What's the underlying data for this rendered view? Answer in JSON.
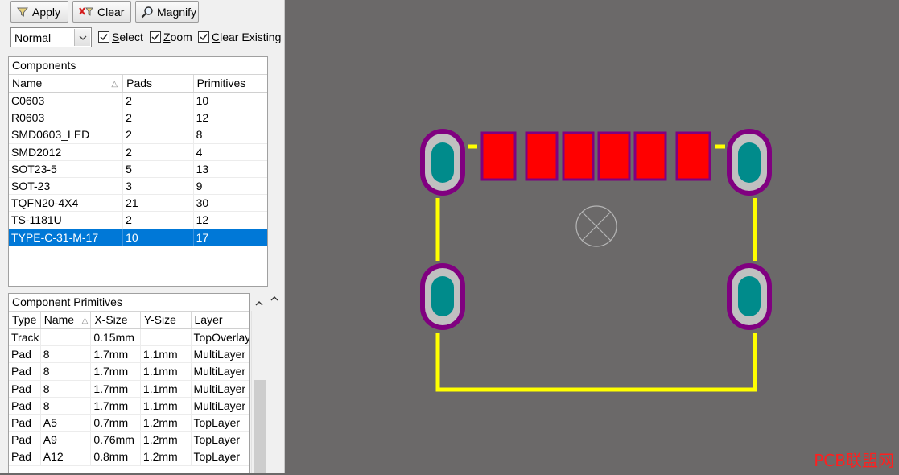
{
  "toolbar": {
    "apply_label": "Apply",
    "clear_label": "Clear",
    "magnify_label": "Magnify"
  },
  "filter": {
    "mode_value": "Normal",
    "select_label": "Select",
    "zoom_label": "Zoom",
    "clear_existing_label": "Clear Existing",
    "select_checked": true,
    "zoom_checked": true,
    "clear_existing_checked": true
  },
  "components": {
    "title": "Components",
    "columns": [
      "Name",
      "Pads",
      "Primitives"
    ],
    "rows": [
      {
        "name": "C0603",
        "pads": "2",
        "primitives": "10"
      },
      {
        "name": "R0603",
        "pads": "2",
        "primitives": "12"
      },
      {
        "name": "SMD0603_LED",
        "pads": "2",
        "primitives": "8"
      },
      {
        "name": "SMD2012",
        "pads": "2",
        "primitives": "4"
      },
      {
        "name": "SOT23-5",
        "pads": "5",
        "primitives": "13"
      },
      {
        "name": "SOT-23",
        "pads": "3",
        "primitives": "9"
      },
      {
        "name": "TQFN20-4X4",
        "pads": "21",
        "primitives": "30"
      },
      {
        "name": "TS-1181U",
        "pads": "2",
        "primitives": "12"
      },
      {
        "name": "TYPE-C-31-M-17",
        "pads": "10",
        "primitives": "17"
      }
    ],
    "selected_index": 8
  },
  "primitives": {
    "title": "Component Primitives",
    "columns": [
      "Type",
      "Name",
      "X-Size",
      "Y-Size",
      "Layer"
    ],
    "rows": [
      {
        "type": "Track",
        "name": "",
        "xsize": "0.15mm",
        "ysize": "",
        "layer": "TopOverlay"
      },
      {
        "type": "Pad",
        "name": "8",
        "xsize": "1.7mm",
        "ysize": "1.1mm",
        "layer": "MultiLayer"
      },
      {
        "type": "Pad",
        "name": "8",
        "xsize": "1.7mm",
        "ysize": "1.1mm",
        "layer": "MultiLayer"
      },
      {
        "type": "Pad",
        "name": "8",
        "xsize": "1.7mm",
        "ysize": "1.1mm",
        "layer": "MultiLayer"
      },
      {
        "type": "Pad",
        "name": "8",
        "xsize": "1.7mm",
        "ysize": "1.1mm",
        "layer": "MultiLayer"
      },
      {
        "type": "Pad",
        "name": "A5",
        "xsize": "0.7mm",
        "ysize": "1.2mm",
        "layer": "TopLayer"
      },
      {
        "type": "Pad",
        "name": "A9",
        "xsize": "0.76mm",
        "ysize": "1.2mm",
        "layer": "TopLayer"
      },
      {
        "type": "Pad",
        "name": "A12",
        "xsize": "0.8mm",
        "ysize": "1.2mm",
        "layer": "TopLayer"
      }
    ]
  },
  "colors": {
    "selection": "#0078d7",
    "canvas_bg": "#6b6969",
    "overlay_yellow": "#ffff00",
    "smd_pad_red": "#ff0000",
    "pad_outline_purple": "#800080",
    "hole_teal": "#008b8b"
  },
  "watermark": "PCB联盟网"
}
